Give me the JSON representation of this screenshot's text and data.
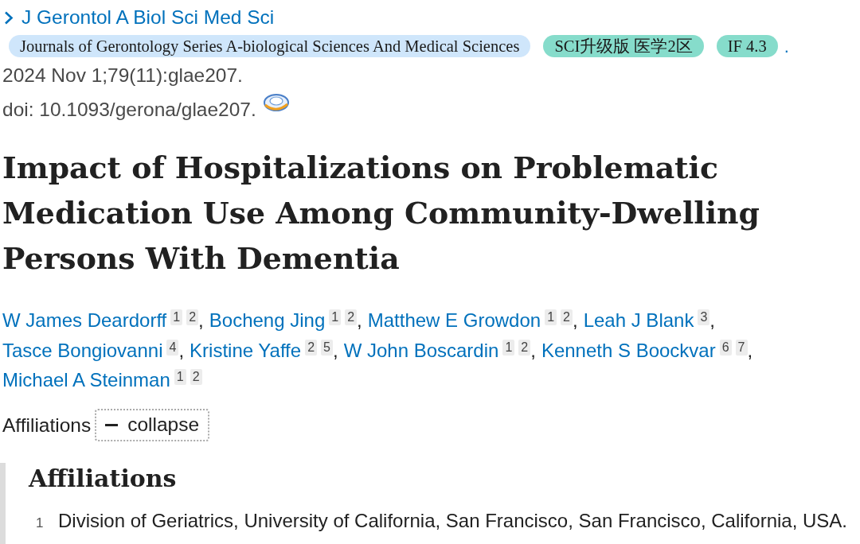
{
  "journal": {
    "abbreviation": "J Gerontol A Biol Sci Med Sci",
    "tags": [
      {
        "label": "Journals of Gerontology Series A-biological Sciences And Medical Sciences",
        "color": "#cfe6fb"
      },
      {
        "label": "SCI升级版 医学2区",
        "color": "#86dccb"
      },
      {
        "label": "IF 4.3",
        "color": "#86dccb"
      }
    ],
    "trailing": "."
  },
  "citation": "2024 Nov 1;79(11):glae207.",
  "doi": "doi: 10.1093/gerona/glae207.",
  "title": "Impact of Hospitalizations on Problematic Medication Use Among Community-Dwelling Persons With Dementia",
  "authors": [
    {
      "name": "W James Deardorff",
      "affiliations": [
        "1",
        "2"
      ],
      "separator": ","
    },
    {
      "name": "Bocheng Jing",
      "affiliations": [
        "1",
        "2"
      ],
      "separator": ","
    },
    {
      "name": "Matthew E Growdon",
      "affiliations": [
        "1",
        "2"
      ],
      "separator": ","
    },
    {
      "name": "Leah J Blank",
      "affiliations": [
        "3"
      ],
      "separator": ","
    },
    {
      "name": "Tasce Bongiovanni",
      "affiliations": [
        "4"
      ],
      "separator": ","
    },
    {
      "name": "Kristine Yaffe",
      "affiliations": [
        "2",
        "5"
      ],
      "separator": ","
    },
    {
      "name": "W John Boscardin",
      "affiliations": [
        "1",
        "2"
      ],
      "separator": ","
    },
    {
      "name": "Kenneth S Boockvar",
      "affiliations": [
        "6",
        "7"
      ],
      "separator": ","
    },
    {
      "name": "Michael A Steinman",
      "affiliations": [
        "1",
        "2"
      ]
    }
  ],
  "affiliations_toggle": {
    "label": "Affiliations",
    "button": "collapse",
    "expanded": true
  },
  "affiliations": {
    "heading": "Affiliations",
    "items": [
      {
        "number": "1",
        "text": "Division of Geriatrics, University of California, San Francisco, San Francisco, California, USA."
      }
    ]
  }
}
